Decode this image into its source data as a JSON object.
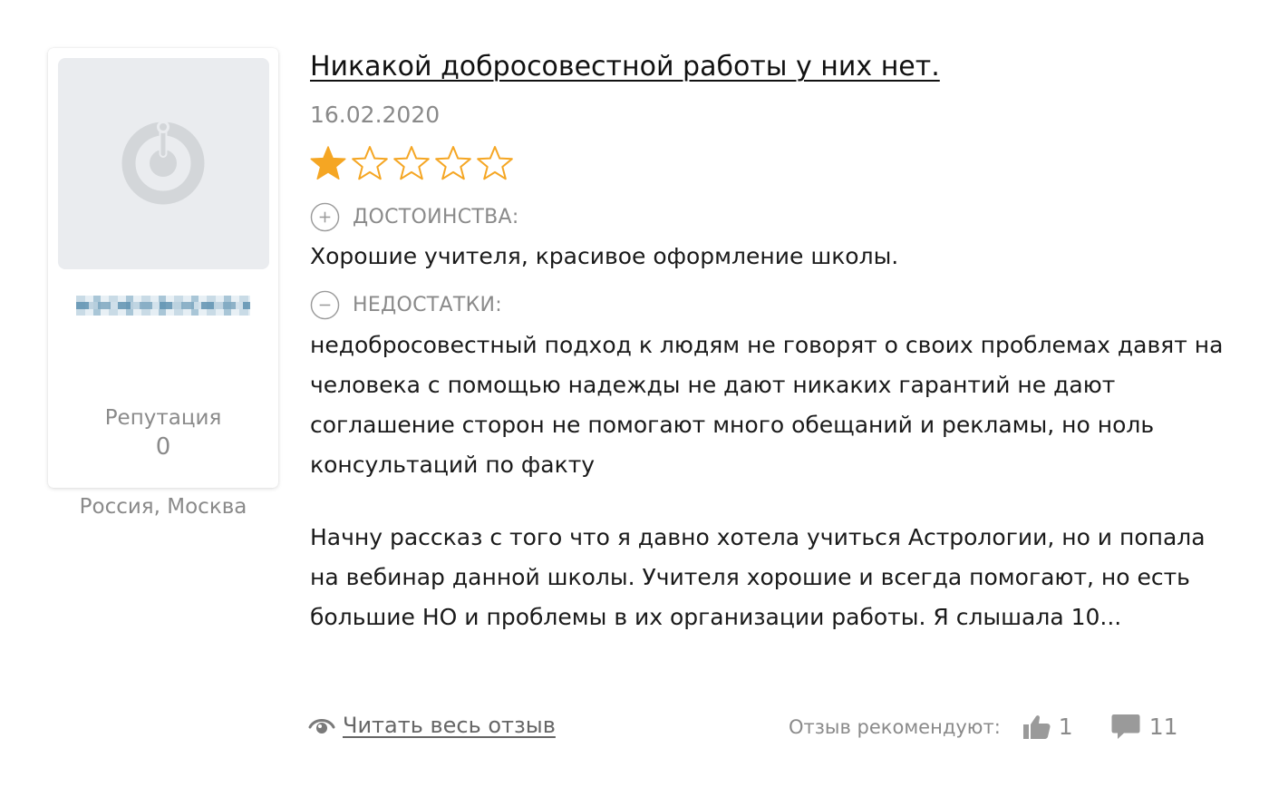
{
  "author": {
    "name_hidden": "",
    "reputation_label": "Репутация",
    "reputation_value": "0",
    "location": "Россия, Москва",
    "avatar_icon": "default-avatar-icon"
  },
  "review": {
    "title": "Никакой добросовестной работы у них нет.",
    "date": "16.02.2020",
    "rating": 1,
    "rating_max": 5,
    "pros_label": "ДОСТОИНСТВА:",
    "pros_text": "Хорошие учителя, красивое оформление школы.",
    "cons_label": "НЕДОСТАТКИ:",
    "cons_text": "недобросовестный подход к людям не говорят о своих проблемах давят на человека с помощью надежды не дают никаких гарантий не дают соглашение сторон не помогают много обещаний и рекламы, но ноль консультаций по факту",
    "excerpt": "Начну рассказ с того что я давно хотела учиться Астрологии, но и попала на вебинар данной школы. Учителя хорошие и всегда помогают, но есть большие НО и проблемы в их организации работы. Я слышала 10..."
  },
  "footer": {
    "read_more_label": "Читать весь отзыв",
    "recommend_label": "Отзыв рекомендуют:",
    "likes_count": "1",
    "comments_count": "11"
  },
  "colors": {
    "star_filled": "#f5a623",
    "star_empty_stroke": "#f5a623",
    "muted_text": "#8a8a8a",
    "avatar_bg": "#eaecef",
    "avatar_icon": "#d3d6d9"
  },
  "icons": {
    "pros": "plus-circle-icon",
    "cons": "minus-circle-icon",
    "read_more": "eye-icon",
    "like": "thumbs-up-icon",
    "comments": "speech-bubble-icon"
  }
}
